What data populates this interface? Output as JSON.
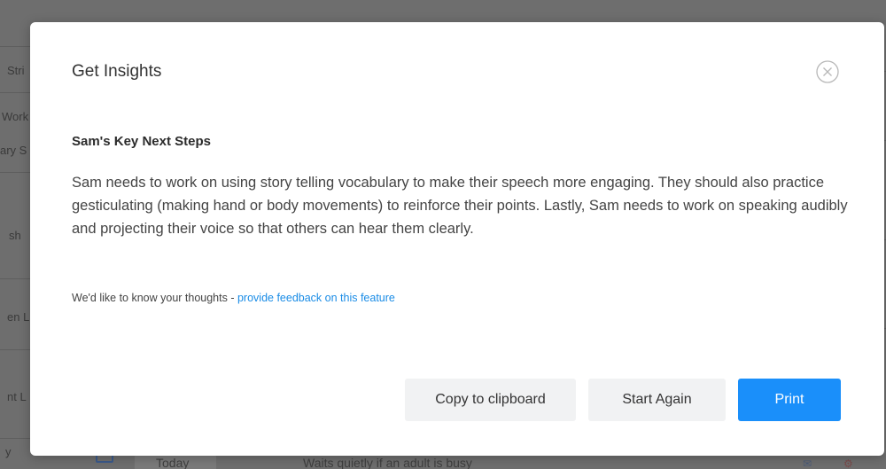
{
  "background": {
    "left_fragments": [
      "Stri",
      "Work",
      "ary S",
      "sh",
      "en L",
      "nt L",
      "y"
    ],
    "bottom_row": {
      "date_label": "Today",
      "behaviour_text": "Waits quietly if an adult is busy"
    }
  },
  "modal": {
    "title": "Get Insights",
    "close_icon": "close-circle-icon",
    "section_title": "Sam's Key Next Steps",
    "body": "Sam needs to work on using story telling vocabulary to make their speech more engaging. They should also practice gesticulating (making hand or body movements) to reinforce their points. Lastly, Sam needs to work on speaking audibly and projecting their voice so that others can hear them clearly.",
    "feedback_prefix": "We'd like to know your thoughts - ",
    "feedback_link": "provide feedback on this feature",
    "buttons": {
      "copy": "Copy to clipboard",
      "start_again": "Start Again",
      "print": "Print"
    }
  },
  "colors": {
    "accent": "#1a8ffa",
    "link": "#1a8ce6",
    "overlay": "#6e6e6e"
  }
}
